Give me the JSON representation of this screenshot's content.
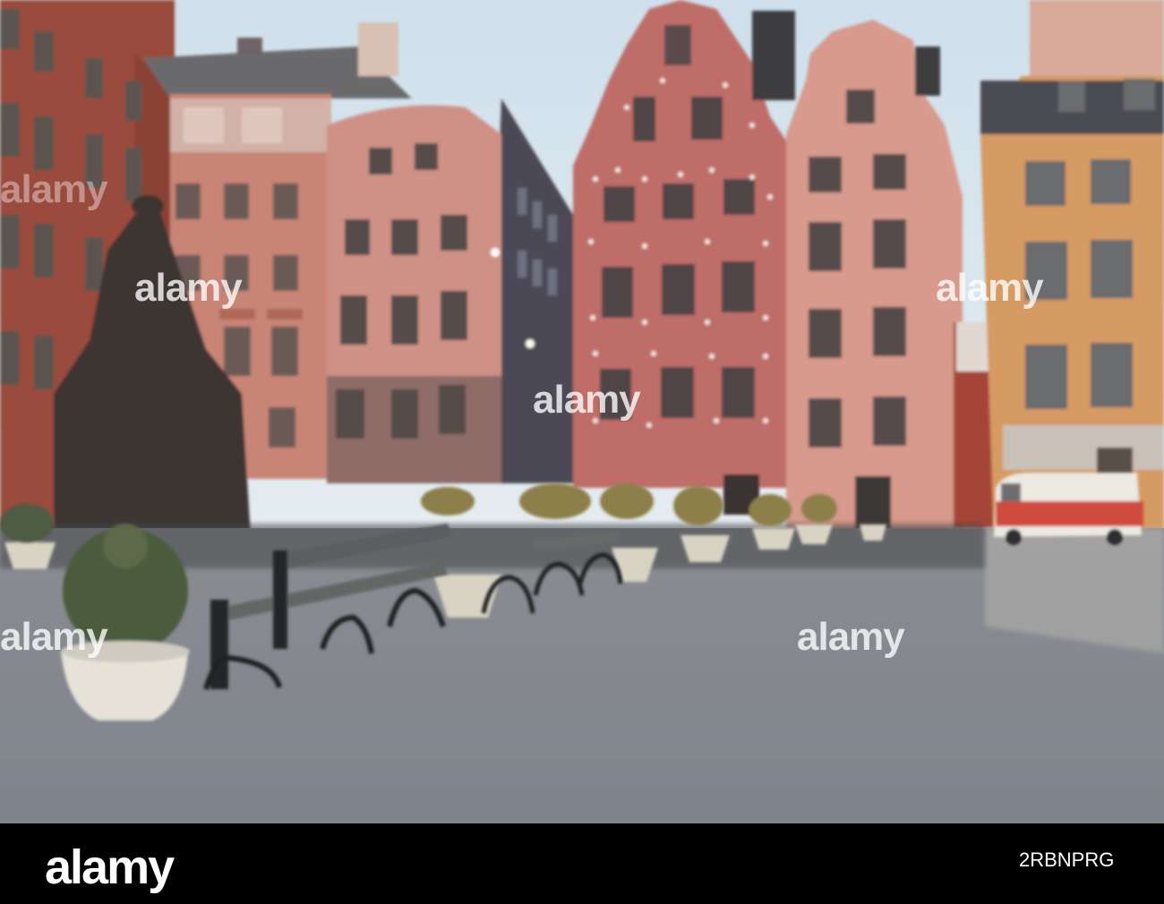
{
  "watermark": {
    "text": "alamy",
    "color": "#ffffff"
  },
  "footer": {
    "logo": "alamy",
    "image_id": "2RBNPRG",
    "background": "#000000"
  },
  "scene": {
    "palette": {
      "sky": "#d9e6ef",
      "pavement": "#8e9298",
      "red_building": "#a85a4a",
      "pink_building": "#c9827a",
      "ochre_building": "#d49b62",
      "van": "#e8e4df"
    }
  }
}
